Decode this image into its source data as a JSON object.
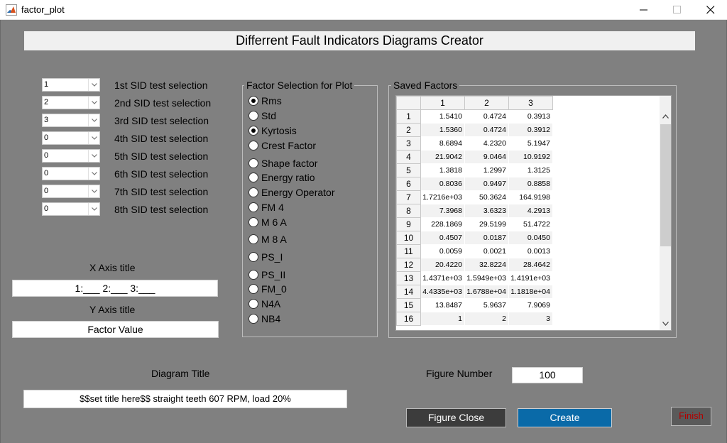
{
  "window": {
    "title": "factor_plot"
  },
  "header": {
    "title": "Differrent Fault Indicators Diagrams Creator"
  },
  "sid_selections": [
    {
      "value": "1",
      "label": "1st SID test selection"
    },
    {
      "value": "2",
      "label": "2nd SID test selection"
    },
    {
      "value": "3",
      "label": "3rd SID test selection"
    },
    {
      "value": "0",
      "label": "4th SID test selection"
    },
    {
      "value": "0",
      "label": "5th SID test selection"
    },
    {
      "value": "0",
      "label": "6th SID test selection"
    },
    {
      "value": "0",
      "label": "7th SID test selection"
    },
    {
      "value": "0",
      "label": "8th SID test selection"
    }
  ],
  "x_axis": {
    "label": "X Axis title",
    "value": "1:___ 2:___ 3:___"
  },
  "y_axis": {
    "label": "Y Axis title",
    "value": "Factor Value"
  },
  "factor_selection": {
    "title": "Factor Selection for Plot",
    "options": [
      {
        "label": "Rms",
        "selected": true
      },
      {
        "label": "Std",
        "selected": false
      },
      {
        "label": "Kyrtosis",
        "selected": true
      },
      {
        "label": "Crest Factor",
        "selected": false
      },
      {
        "label": "Shape factor",
        "selected": false
      },
      {
        "label": "Energy ratio",
        "selected": false
      },
      {
        "label": "Energy Operator",
        "selected": false
      },
      {
        "label": "FM 4",
        "selected": false
      },
      {
        "label": "M 6 A",
        "selected": false
      },
      {
        "label": "M 8 A",
        "selected": false
      },
      {
        "label": "PS_I",
        "selected": false
      },
      {
        "label": "PS_II",
        "selected": false
      },
      {
        "label": "FM_0",
        "selected": false
      },
      {
        "label": "N4A",
        "selected": false
      },
      {
        "label": "NB4",
        "selected": false
      }
    ]
  },
  "saved_factors": {
    "title": "Saved Factors",
    "columns": [
      "1",
      "2",
      "3"
    ],
    "rows": [
      {
        "index": "1",
        "values": [
          "1.5410",
          "0.4724",
          "0.3913"
        ]
      },
      {
        "index": "2",
        "values": [
          "1.5360",
          "0.4724",
          "0.3912"
        ]
      },
      {
        "index": "3",
        "values": [
          "8.6894",
          "4.2320",
          "5.1947"
        ]
      },
      {
        "index": "4",
        "values": [
          "21.9042",
          "9.0464",
          "10.9192"
        ]
      },
      {
        "index": "5",
        "values": [
          "1.3818",
          "1.2997",
          "1.3125"
        ]
      },
      {
        "index": "6",
        "values": [
          "0.8036",
          "0.9497",
          "0.8858"
        ]
      },
      {
        "index": "7",
        "values": [
          "1.7216e+03",
          "50.3624",
          "164.9198"
        ]
      },
      {
        "index": "8",
        "values": [
          "7.3968",
          "3.6323",
          "4.2913"
        ]
      },
      {
        "index": "9",
        "values": [
          "228.1869",
          "29.5199",
          "51.4722"
        ]
      },
      {
        "index": "10",
        "values": [
          "0.4507",
          "0.0187",
          "0.0450"
        ]
      },
      {
        "index": "11",
        "values": [
          "0.0059",
          "0.0021",
          "0.0013"
        ]
      },
      {
        "index": "12",
        "values": [
          "20.4220",
          "32.8224",
          "28.4642"
        ]
      },
      {
        "index": "13",
        "values": [
          "1.4371e+03",
          "1.5949e+03",
          "1.4191e+03"
        ]
      },
      {
        "index": "14",
        "values": [
          "4.4335e+03",
          "1.6788e+04",
          "1.1818e+04"
        ]
      },
      {
        "index": "15",
        "values": [
          "13.8487",
          "5.9637",
          "7.9069"
        ]
      },
      {
        "index": "16",
        "values": [
          "1",
          "2",
          "3"
        ]
      }
    ]
  },
  "diagram_title": {
    "label": "Diagram Title",
    "value": "$$set  title here$$  straight teeth  607 RPM, load 20%"
  },
  "figure_number": {
    "label": "Figure Number",
    "value": "100"
  },
  "buttons": {
    "figure_close": "Figure Close",
    "create": "Create",
    "finish": "Finish"
  },
  "colors": {
    "background": "#808080",
    "create_button": "#0a6aa8",
    "close_button": "#3c3c3c",
    "finish_text": "#b30000"
  }
}
